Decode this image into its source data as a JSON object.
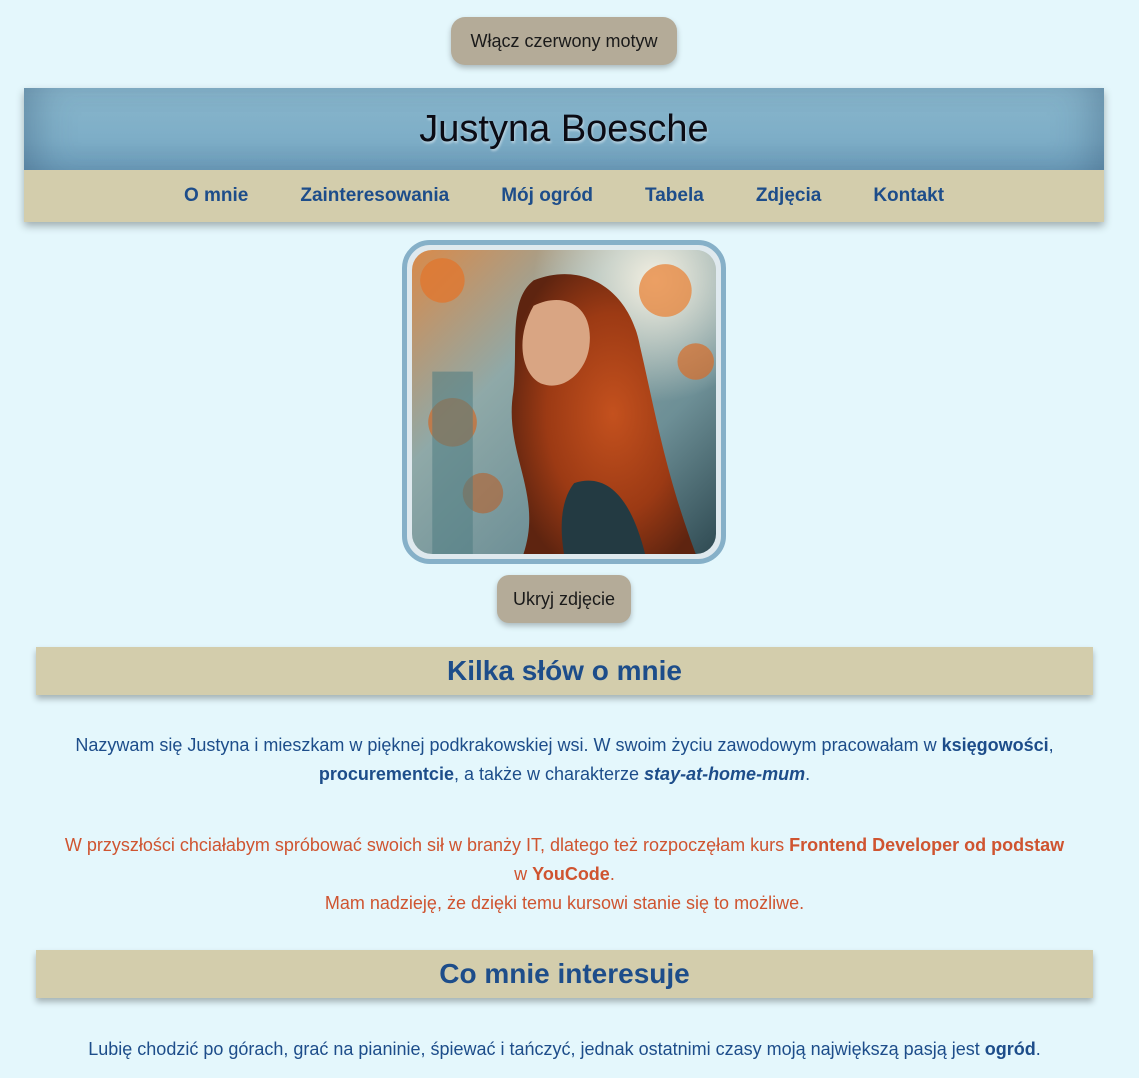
{
  "theme_button": "Włącz czerwony motyw",
  "header": {
    "title": "Justyna Boesche"
  },
  "nav": {
    "items": [
      "O mnie",
      "Zainteresowania",
      "Mój ogród",
      "Tabela",
      "Zdjęcia",
      "Kontakt"
    ]
  },
  "photo": {
    "hide_button": "Ukryj zdjęcie"
  },
  "about": {
    "heading": "Kilka słów o mnie",
    "p1_a": "Nazywam się Justyna i mieszkam w pięknej podkrakowskiej wsi. W swoim życiu zawodowym pracowałam w ",
    "p1_b": "księgowości",
    "p1_c": ",",
    "p1_d": "procurementcie",
    "p1_e": ", a także w charakterze ",
    "p1_f": "stay-at-home-mum",
    "p1_g": ".",
    "p2_a": "W przyszłości chciałabym spróbować swoich sił w branży IT, dlatego też rozpoczęłam kurs ",
    "p2_b": "Frontend Developer od podstaw",
    "p2_c": "w ",
    "p2_d": "YouCode",
    "p2_e": ".",
    "p2_f": "Mam nadzieję, że dzięki temu kursowi stanie się to możliwe."
  },
  "interests": {
    "heading": "Co mnie interesuje",
    "p_a": "Lubię chodzić po górach, grać na pianinie, śpiewać i tańczyć, jednak ostatnimi czasy moją największą pasją jest ",
    "p_b": "ogród",
    "p_c": "."
  },
  "colors": {
    "background": "#e4f7fc",
    "text_blue": "#1d4d8a",
    "text_orange": "#cf5430",
    "beige": "#d3cdac",
    "header_blue": "#7eaec7",
    "button": "#b4ab98"
  }
}
